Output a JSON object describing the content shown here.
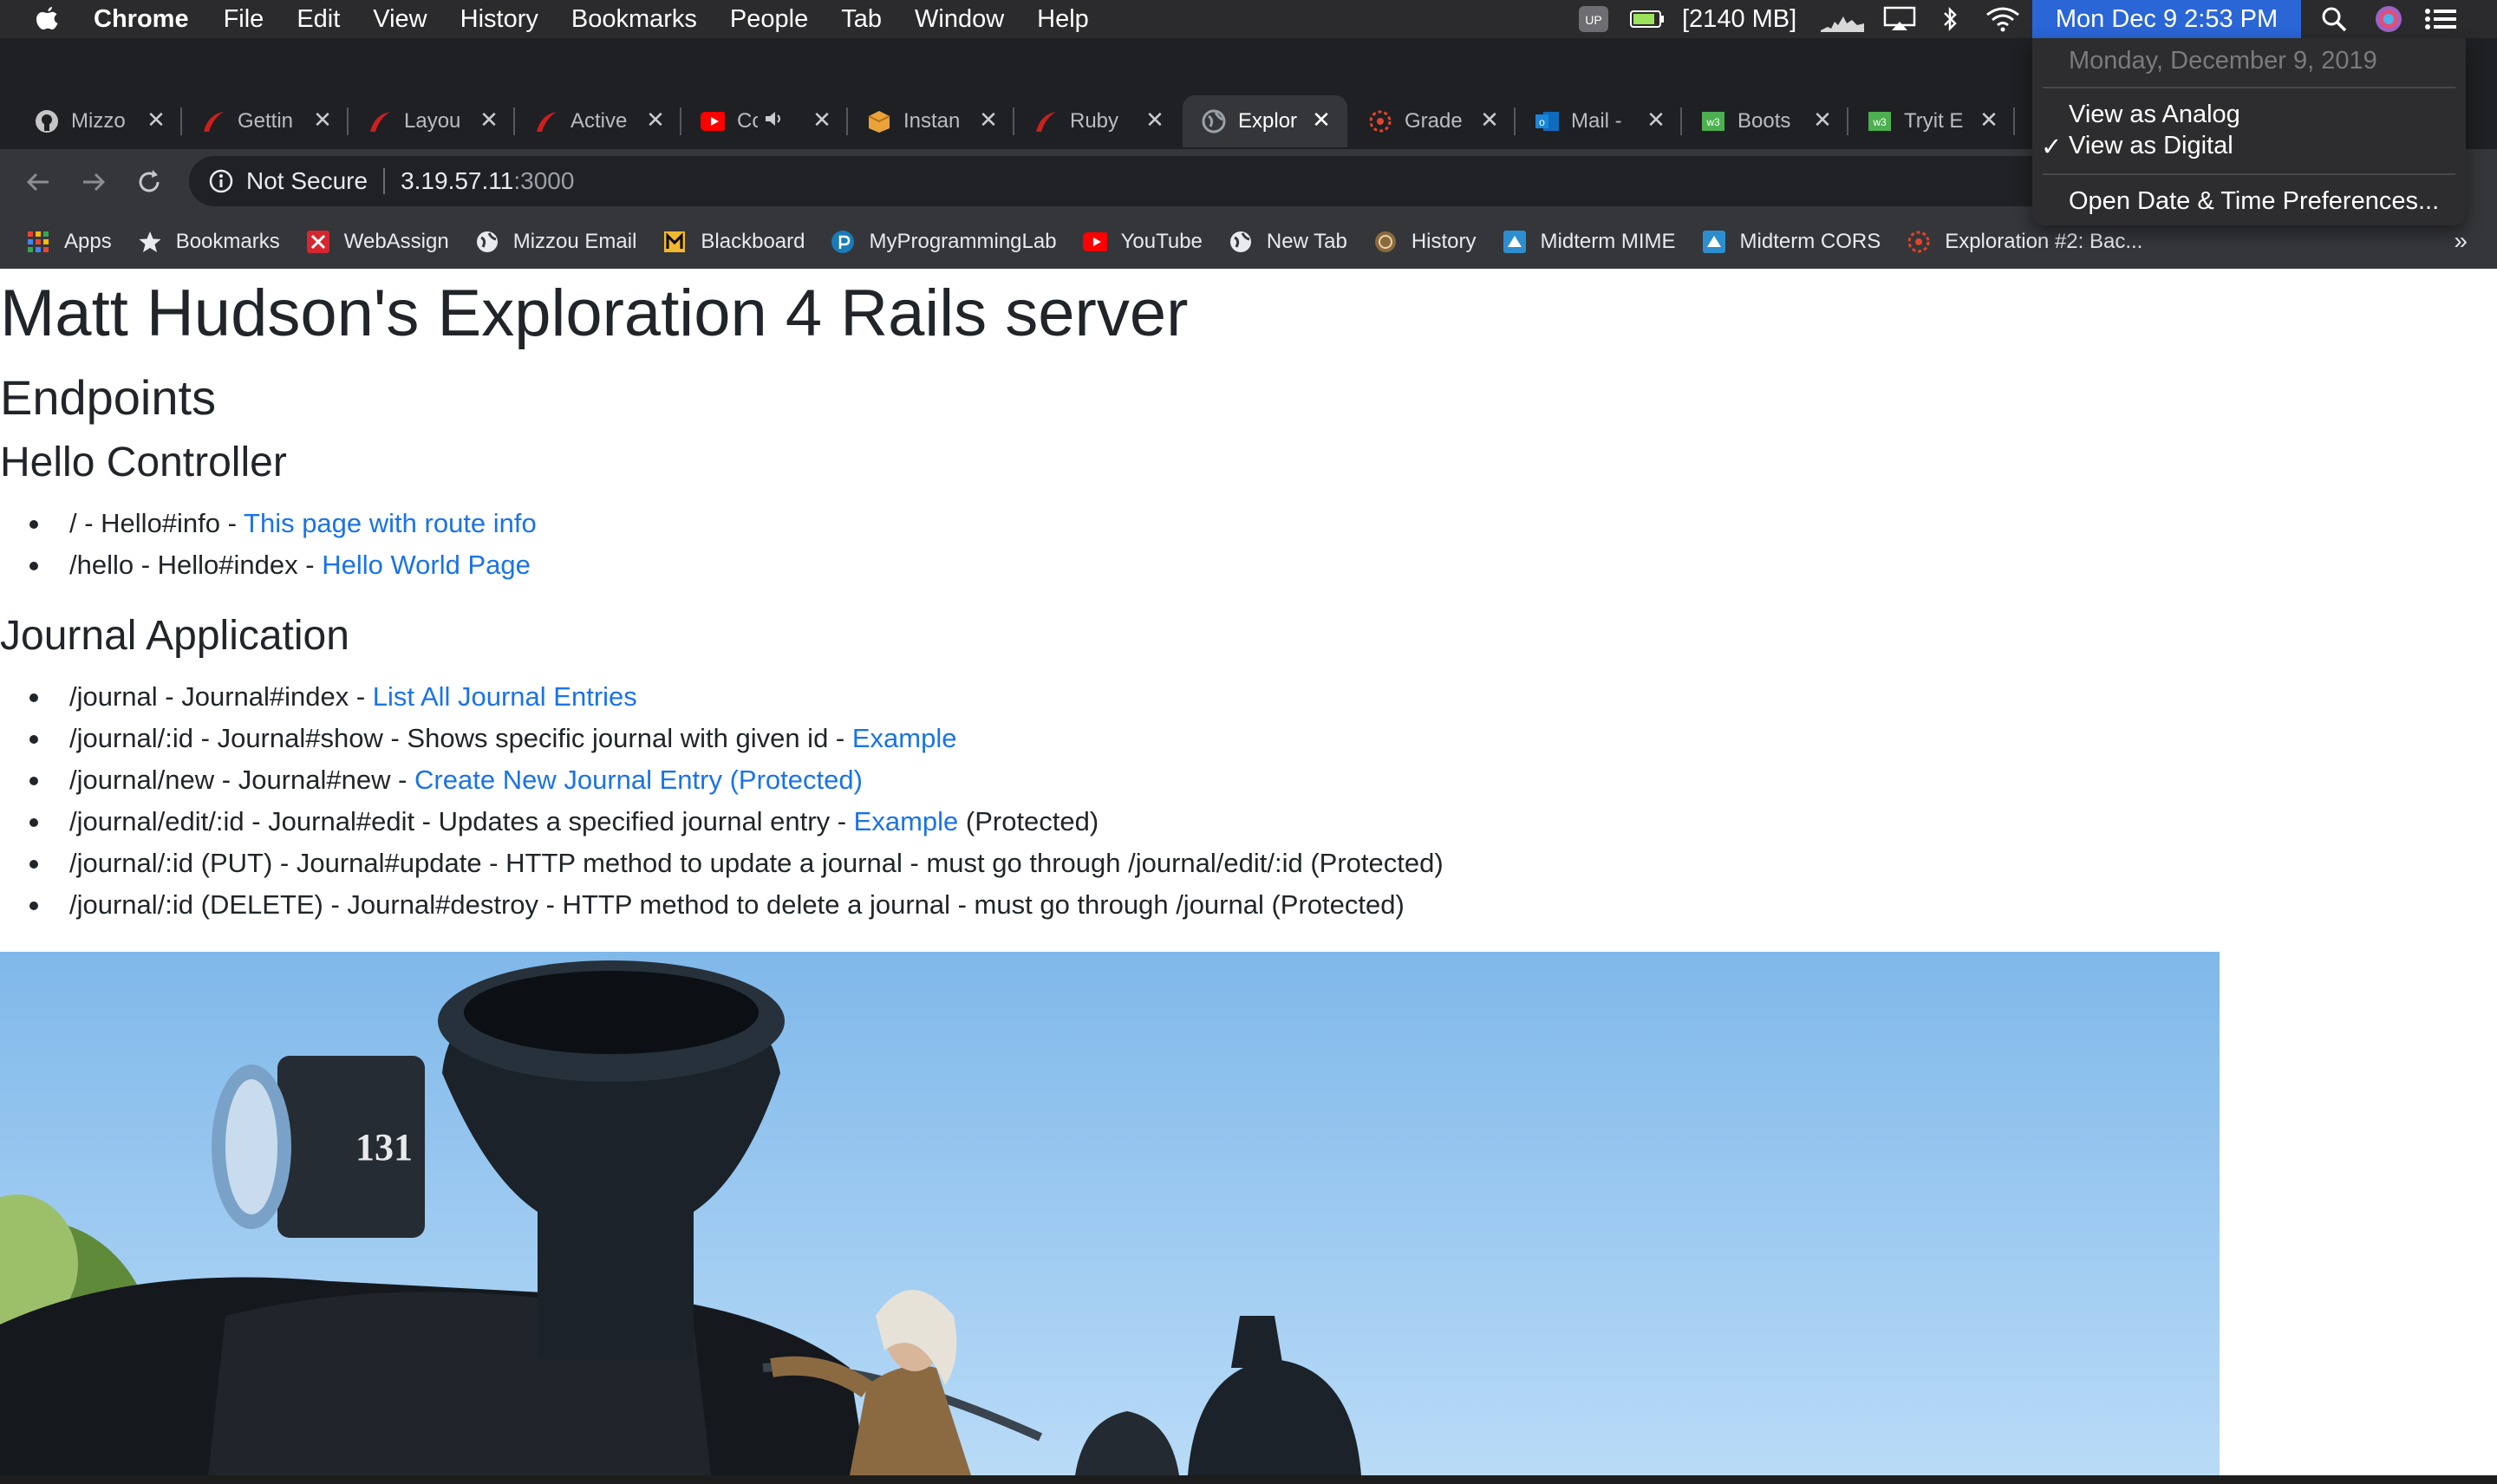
{
  "menubar": {
    "app_name": "Chrome",
    "items": [
      "File",
      "Edit",
      "View",
      "History",
      "Bookmarks",
      "People",
      "Tab",
      "Window",
      "Help"
    ],
    "memory": "[2140 MB]",
    "clock": "Mon Dec 9  2:53 PM"
  },
  "clock_menu": {
    "date": "Monday, December 9, 2019",
    "analog": "View as Analog",
    "digital": "View as Digital",
    "checkmark": "✓",
    "preferences": "Open Date & Time Preferences..."
  },
  "tabs": [
    {
      "title": "Mizzo",
      "icon": "github-icon"
    },
    {
      "title": "Gettin",
      "icon": "rails-icon"
    },
    {
      "title": "Layou",
      "icon": "rails-icon"
    },
    {
      "title": "Active",
      "icon": "rails-icon"
    },
    {
      "title": "Co",
      "icon": "youtube-icon"
    },
    {
      "title": "Instan",
      "icon": "box-icon"
    },
    {
      "title": "Ruby",
      "icon": "rails-icon"
    },
    {
      "title": "Explor",
      "icon": "globe-icon",
      "active": true
    },
    {
      "title": "Grade",
      "icon": "canvas-icon"
    },
    {
      "title": "Mail -",
      "icon": "outlook-icon"
    },
    {
      "title": "Boots",
      "icon": "w3-icon"
    },
    {
      "title": "Tryit E",
      "icon": "w3-icon"
    }
  ],
  "toolbar": {
    "security": "Not Secure",
    "host": "3.19.57.11",
    "port": ":3000"
  },
  "bookmarks": [
    {
      "label": "Apps",
      "icon": "apps-grid-icon"
    },
    {
      "label": "Bookmarks",
      "icon": "star-icon"
    },
    {
      "label": "WebAssign",
      "icon": "webassign-icon"
    },
    {
      "label": "Mizzou Email",
      "icon": "globe-icon"
    },
    {
      "label": "Blackboard",
      "icon": "mizzou-icon"
    },
    {
      "label": "MyProgrammingLab",
      "icon": "pearson-icon"
    },
    {
      "label": "YouTube",
      "icon": "youtube-icon"
    },
    {
      "label": "New Tab",
      "icon": "globe-icon"
    },
    {
      "label": "History",
      "icon": "history-icon"
    },
    {
      "label": "Midterm MIME",
      "icon": "canvas-badge-icon"
    },
    {
      "label": "Midterm CORS",
      "icon": "canvas-badge-icon"
    },
    {
      "label": "Exploration #2: Bac...",
      "icon": "canvas-icon"
    }
  ],
  "bookmarks_more": "»",
  "page": {
    "title": "Matt Hudson's Exploration 4 Rails server",
    "endpoints_heading": "Endpoints",
    "hello_heading": "Hello Controller",
    "hello_items": [
      {
        "text": "/ - Hello#info - ",
        "link": "This page with route info",
        "after": ""
      },
      {
        "text": "/hello - Hello#index - ",
        "link": "Hello World Page",
        "after": ""
      }
    ],
    "journal_heading": "Journal Application",
    "journal_items": [
      {
        "text": "/journal - Journal#index - ",
        "link": "List All Journal Entries",
        "after": ""
      },
      {
        "text": "/journal/:id - Journal#show - Shows specific journal with given id - ",
        "link": "Example",
        "after": ""
      },
      {
        "text": "/journal/new - Journal#new - ",
        "link": "Create New Journal Entry (Protected)",
        "after": ""
      },
      {
        "text": "/journal/edit/:id - Journal#edit - Updates a specified journal entry - ",
        "link": "Example",
        "after": " (Protected)"
      },
      {
        "text": "/journal/:id (PUT) - Journal#update - HTTP method to update a journal - must go through /journal/edit/:id (Protected)",
        "link": "",
        "after": ""
      },
      {
        "text": "/journal/:id (DELETE) - Journal#destroy - HTTP method to delete a journal - must go through /journal (Protected)",
        "link": "",
        "after": ""
      }
    ],
    "locomotive_number": "131"
  },
  "colors": {
    "link": "#1a73e8",
    "clock_highlight": "#2b66d7",
    "sky": "#8ec1ec"
  }
}
